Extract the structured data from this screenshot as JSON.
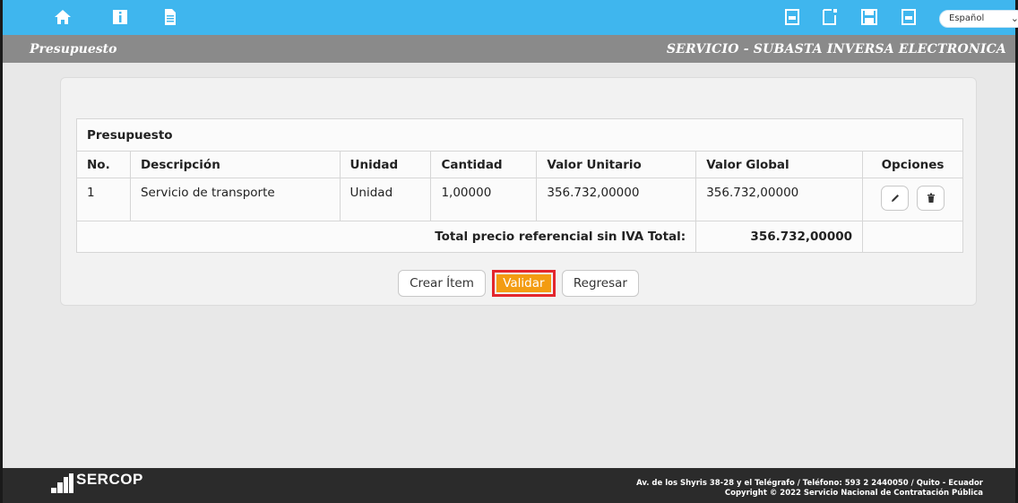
{
  "subheader": {
    "module": "Presupuesto",
    "process": "SERVICIO - SUBASTA INVERSA ELECTRONICA"
  },
  "language_select": {
    "value": "Español"
  },
  "topbar_icons": {
    "left": [
      "home-icon",
      "info-icon",
      "document-icon"
    ],
    "right": [
      "pdf-icon",
      "new-document-icon",
      "save-icon",
      "pdf-icon"
    ]
  },
  "budget": {
    "caption": "Presupuesto",
    "headers": [
      "No.",
      "Descripción",
      "Unidad",
      "Cantidad",
      "Valor Unitario",
      "Valor Global",
      "Opciones"
    ],
    "rows": [
      {
        "no": "1",
        "description": "Servicio de transporte",
        "unit": "Unidad",
        "quantity": "1,00000",
        "unit_value": "356.732,00000",
        "global_value": "356.732,00000"
      }
    ],
    "total_label": "Total precio referencial sin IVA Total:",
    "total_value": "356.732,00000"
  },
  "actions": {
    "create": "Crear Ítem",
    "validate": "Validar",
    "back": "Regresar"
  },
  "footer": {
    "logo": "SERCOP",
    "address": "Av. de los Shyris 38-28 y el Telégrafo / Teléfono: 593 2 2440050 / Quito - Ecuador",
    "copyright": "Copyright © 2022 Servicio Nacional de Contratación Pública"
  },
  "colors": {
    "topbar": "#3fb6ee",
    "subbar": "#8a8a8a",
    "validate": "#f39c12",
    "highlight": "#e3262d",
    "footer": "#2b2b2b"
  }
}
